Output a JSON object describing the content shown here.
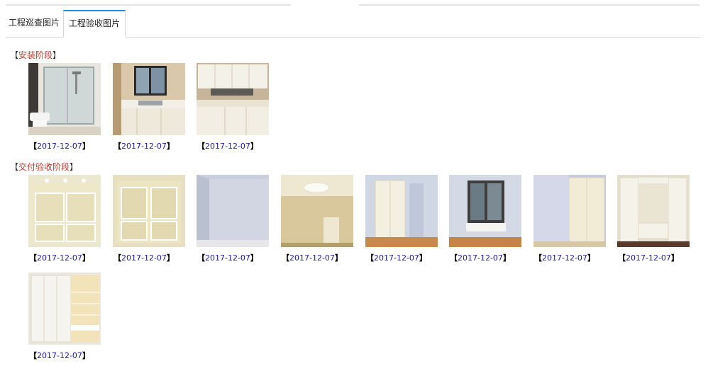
{
  "tabs": [
    {
      "label": "工程巡查图片",
      "active": false
    },
    {
      "label": "工程验收图片",
      "active": true
    }
  ],
  "sections": [
    {
      "title": "安装阶段",
      "photos": [
        {
          "date": "2017-12-07",
          "scene": "shower"
        },
        {
          "date": "2017-12-07",
          "scene": "kitchen-window"
        },
        {
          "date": "2017-12-07",
          "scene": "kitchen-cabinet"
        }
      ]
    },
    {
      "title": "交付验收阶段",
      "photos": [
        {
          "date": "2017-12-07",
          "scene": "wall-panel-lights"
        },
        {
          "date": "2017-12-07",
          "scene": "wall-panel"
        },
        {
          "date": "2017-12-07",
          "scene": "blue-room"
        },
        {
          "date": "2017-12-07",
          "scene": "ceiling-light"
        },
        {
          "date": "2017-12-07",
          "scene": "wardrobe-door"
        },
        {
          "date": "2017-12-07",
          "scene": "bedroom-window"
        },
        {
          "date": "2017-12-07",
          "scene": "sliding-wardrobe"
        },
        {
          "date": "2017-12-07",
          "scene": "wardrobe-bench"
        },
        {
          "date": "2017-12-07",
          "scene": "wardrobe-shelves"
        }
      ]
    }
  ],
  "bracket_open": "【",
  "bracket_close": "】",
  "colors": {
    "tab_active_border": "#2a8bd8",
    "section_title": "#c0392b",
    "date_link": "#1a1aa8"
  }
}
